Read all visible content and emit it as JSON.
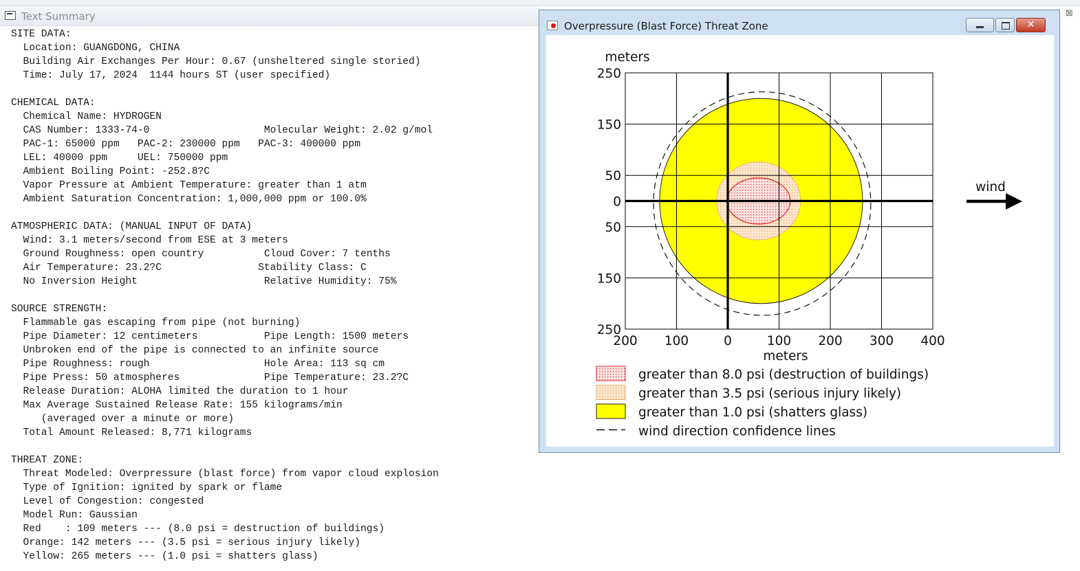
{
  "summary_window": {
    "title": "Text Summary",
    "text": "SITE DATA:\n  Location: GUANGDONG, CHINA\n  Building Air Exchanges Per Hour: 0.67 (unsheltered single storied)\n  Time: July 17, 2024  1144 hours ST (user specified)\n\nCHEMICAL DATA:\n  Chemical Name: HYDROGEN\n  CAS Number: 1333-74-0                   Molecular Weight: 2.02 g/mol\n  PAC-1: 65000 ppm   PAC-2: 230000 ppm   PAC-3: 400000 ppm\n  LEL: 40000 ppm     UEL: 750000 ppm\n  Ambient Boiling Point: -252.8?C\n  Vapor Pressure at Ambient Temperature: greater than 1 atm\n  Ambient Saturation Concentration: 1,000,000 ppm or 100.0%\n\nATMOSPHERIC DATA: (MANUAL INPUT OF DATA)\n  Wind: 3.1 meters/second from ESE at 3 meters\n  Ground Roughness: open country          Cloud Cover: 7 tenths\n  Air Temperature: 23.2?C                Stability Class: C\n  No Inversion Height                     Relative Humidity: 75%\n\nSOURCE STRENGTH:\n  Flammable gas escaping from pipe (not burning)\n  Pipe Diameter: 12 centimeters           Pipe Length: 1500 meters\n  Unbroken end of the pipe is connected to an infinite source\n  Pipe Roughness: rough                   Hole Area: 113 sq cm\n  Pipe Press: 50 atmospheres              Pipe Temperature: 23.2?C\n  Release Duration: ALOHA limited the duration to 1 hour\n  Max Average Sustained Release Rate: 155 kilograms/min\n     (averaged over a minute or more)\n  Total Amount Released: 8,771 kilograms\n\nTHREAT ZONE:\n  Threat Modeled: Overpressure (blast force) from vapor cloud explosion\n  Type of Ignition: ignited by spark or flame\n  Level of Congestion: congested\n  Model Run: Gaussian\n  Red    : 109 meters --- (8.0 psi = destruction of buildings)\n  Orange: 142 meters --- (3.5 psi = serious injury likely)\n  Yellow: 265 meters --- (1.0 psi = shatters glass)"
  },
  "threat_window": {
    "title": "Overpressure (Blast Force) Threat Zone",
    "close_glyph": "✕"
  },
  "right_edge_glyph": "⊠",
  "chart_data": {
    "type": "threat-zone-map",
    "x_label": "meters",
    "y_label": "meters",
    "x_ticks": [
      "200",
      "100",
      "0",
      "100",
      "200",
      "300",
      "400"
    ],
    "x_tick_values": [
      -200,
      -100,
      0,
      100,
      200,
      300,
      400
    ],
    "y_ticks": [
      "250",
      "150",
      "50",
      "0",
      "50",
      "150",
      "250"
    ],
    "y_tick_values": [
      250,
      150,
      50,
      0,
      -50,
      -150,
      -250
    ],
    "xlim": [
      -200,
      400
    ],
    "ylim": [
      -250,
      250
    ],
    "grid": true,
    "wind_label": "wind",
    "wind_direction": "east",
    "zones": [
      {
        "name": "greater than 8.0 psi (destruction of buildings)",
        "color": "#e03030",
        "fill": "#f7d2cf",
        "pattern": "dots",
        "cx": 60,
        "cy": 0,
        "rx": 62,
        "ry": 45
      },
      {
        "name": "greater than 3.5 psi (serious injury likely)",
        "color": "#f3b27a",
        "fill": "#fbe1c5",
        "pattern": "dots",
        "cx": 60,
        "cy": 0,
        "rx": 82,
        "ry": 76
      },
      {
        "name": "greater than 1.0 psi (shatters glass)",
        "color": "#000000",
        "fill": "#ffff00",
        "pattern": "solid",
        "cx": 65,
        "cy": 0,
        "rx": 198,
        "ry": 200
      }
    ],
    "confidence_lines": {
      "name": "wind direction confidence lines",
      "cx": 67,
      "cy": -5,
      "rx": 212,
      "ry": 218
    },
    "legend": [
      {
        "label": "greater than 8.0 psi (destruction of buildings)",
        "swatch": "red-dots"
      },
      {
        "label": "greater than 3.5 psi (serious injury likely)",
        "swatch": "orange-dots"
      },
      {
        "label": "greater than 1.0 psi (shatters glass)",
        "swatch": "yellow"
      },
      {
        "label": "wind direction confidence lines",
        "swatch": "dashed"
      }
    ]
  }
}
